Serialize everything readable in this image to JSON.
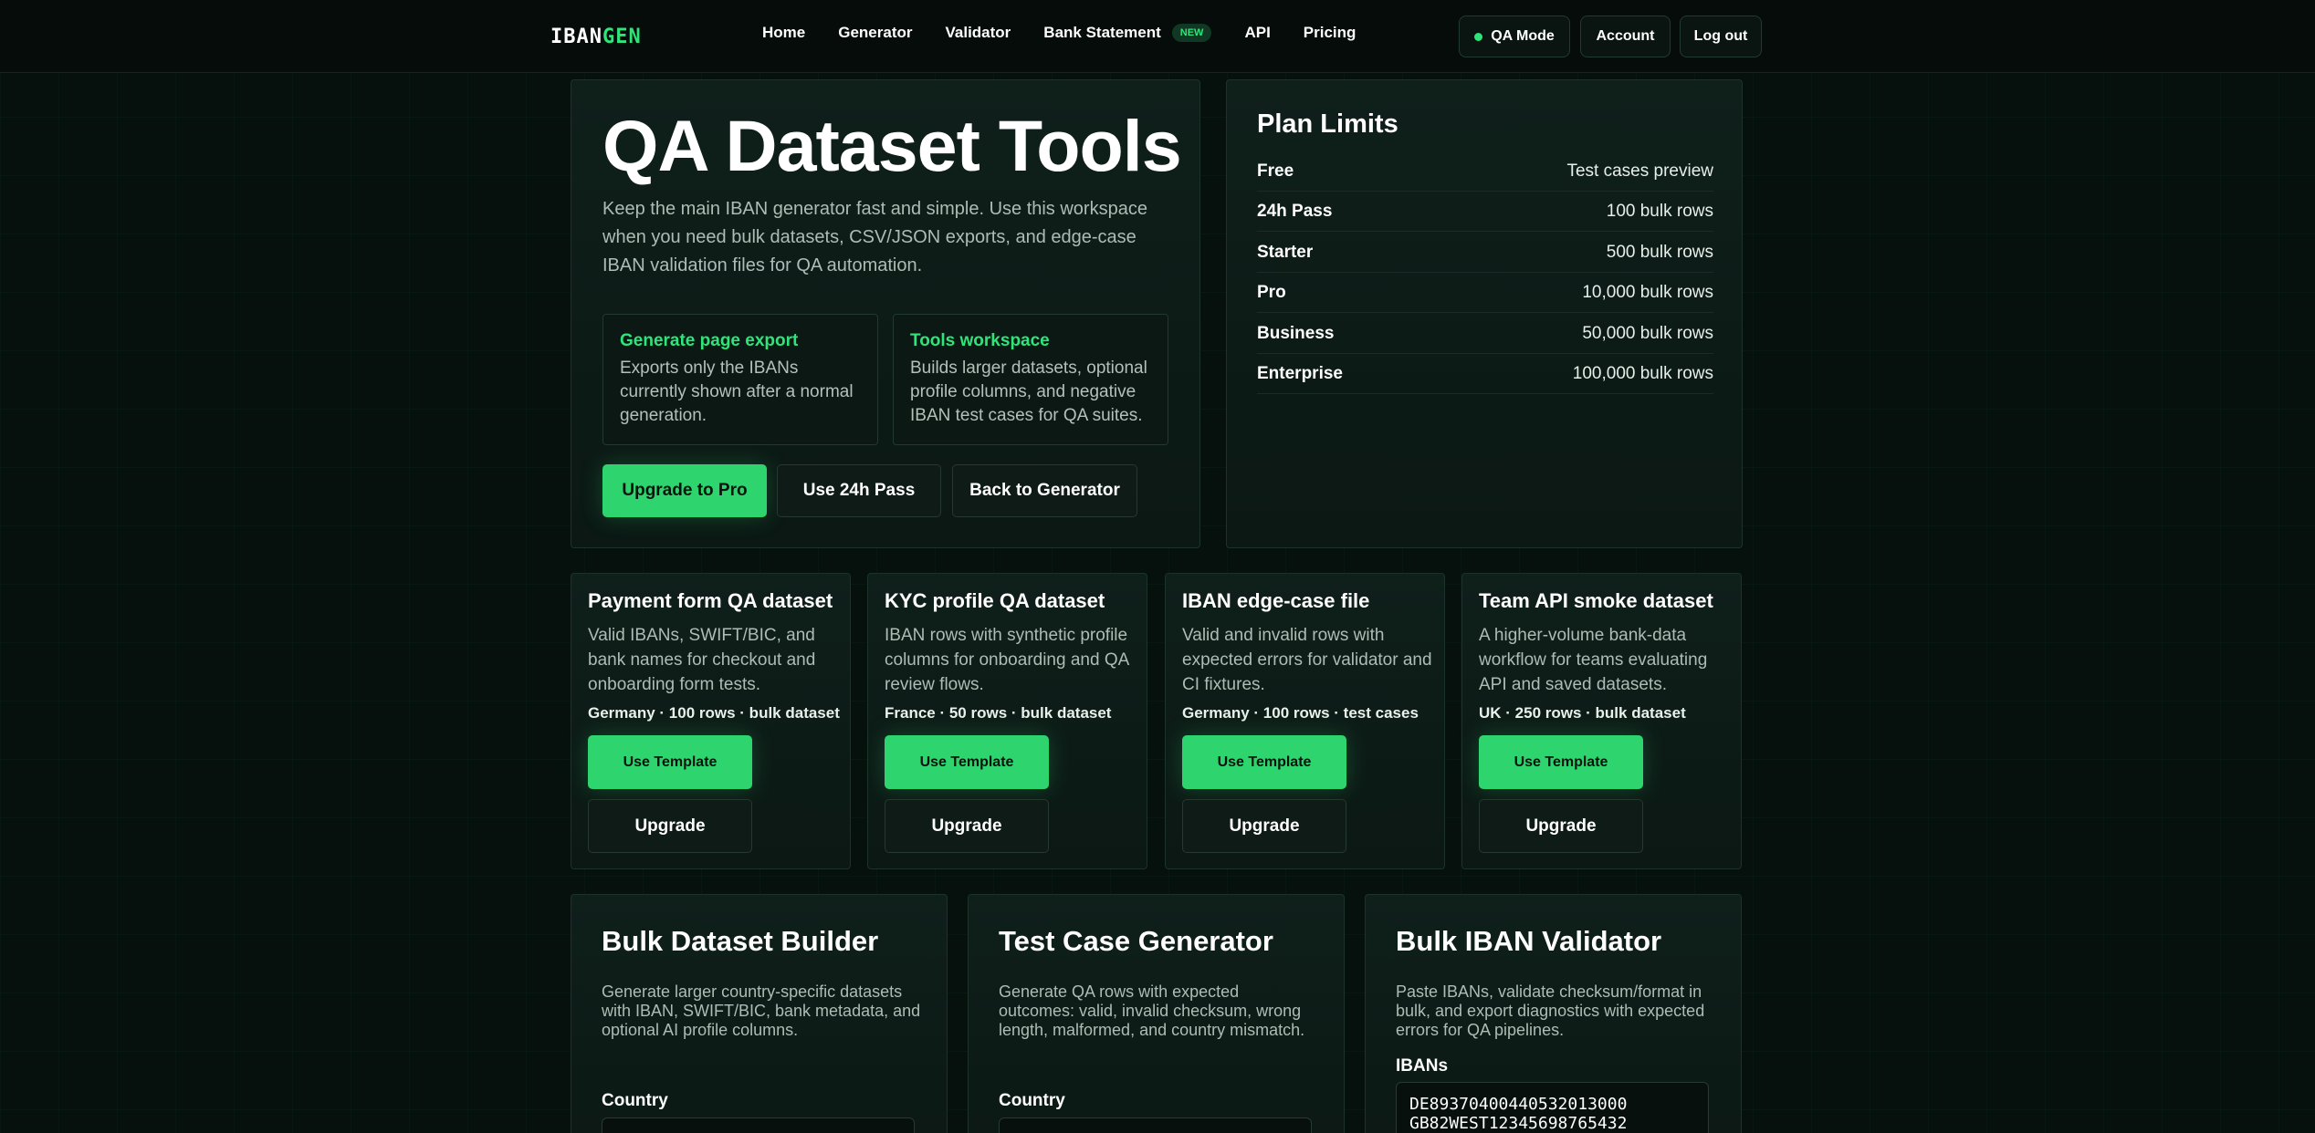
{
  "nav": {
    "logo_part1": "IBAN",
    "logo_part2": "GEN",
    "links": [
      "Home",
      "Generator",
      "Validator",
      "Bank Statement",
      "API",
      "Pricing"
    ],
    "new_badge": "NEW",
    "qa_mode": "QA Mode",
    "account": "Account",
    "logout": "Log out"
  },
  "hero": {
    "title": "QA Dataset Tools",
    "description": "Keep the main IBAN generator fast and simple. Use this workspace when you need bulk datasets, CSV/JSON exports, and edge-case IBAN validation files for QA automation.",
    "cards": [
      {
        "title": "Generate page export",
        "text": "Exports only the IBANs currently shown after a normal generation."
      },
      {
        "title": "Tools workspace",
        "text": "Builds larger datasets, optional profile columns, and negative IBAN test cases for QA suites."
      }
    ],
    "buttons": {
      "upgrade": "Upgrade to Pro",
      "pass": "Use 24h Pass",
      "back": "Back to Generator"
    }
  },
  "limits": {
    "title": "Plan Limits",
    "rows": [
      {
        "plan": "Free",
        "value": "Test cases preview"
      },
      {
        "plan": "24h Pass",
        "value": "100 bulk rows"
      },
      {
        "plan": "Starter",
        "value": "500 bulk rows"
      },
      {
        "plan": "Pro",
        "value": "10,000 bulk rows"
      },
      {
        "plan": "Business",
        "value": "50,000 bulk rows"
      },
      {
        "plan": "Enterprise",
        "value": "100,000 bulk rows"
      }
    ]
  },
  "templates": [
    {
      "title": "Payment form QA dataset",
      "desc": "Valid IBANs, SWIFT/BIC, and bank names for checkout and onboarding form tests.",
      "meta": "Germany · 100 rows · bulk dataset",
      "use": "Use Template",
      "upgrade": "Upgrade"
    },
    {
      "title": "KYC profile QA dataset",
      "desc": "IBAN rows with synthetic profile columns for onboarding and QA review flows.",
      "meta": "France · 50 rows · bulk dataset",
      "use": "Use Template",
      "upgrade": "Upgrade"
    },
    {
      "title": "IBAN edge-case file",
      "desc": "Valid and invalid rows with expected errors for validator and CI fixtures.",
      "meta": "Germany · 100 rows · test cases",
      "use": "Use Template",
      "upgrade": "Upgrade"
    },
    {
      "title": "Team API smoke dataset",
      "desc": "A higher-volume bank-data workflow for teams evaluating API and saved datasets.",
      "meta": "UK · 250 rows · bulk dataset",
      "use": "Use Template",
      "upgrade": "Upgrade"
    }
  ],
  "tools": [
    {
      "title": "Bulk Dataset Builder",
      "desc": "Generate larger country-specific datasets with IBAN, SWIFT/BIC, bank metadata, and optional AI profile columns.",
      "label": "Country"
    },
    {
      "title": "Test Case Generator",
      "desc": "Generate QA rows with expected outcomes: valid, invalid checksum, wrong length, malformed, and country mismatch.",
      "label": "Country"
    },
    {
      "title": "Bulk IBAN Validator",
      "desc": "Paste IBANs, validate checksum/format in bulk, and export diagnostics with expected errors for QA pipelines.",
      "label": "IBANs",
      "textarea": "DE89370400440532013000\nGB82WEST12345698765432"
    }
  ]
}
